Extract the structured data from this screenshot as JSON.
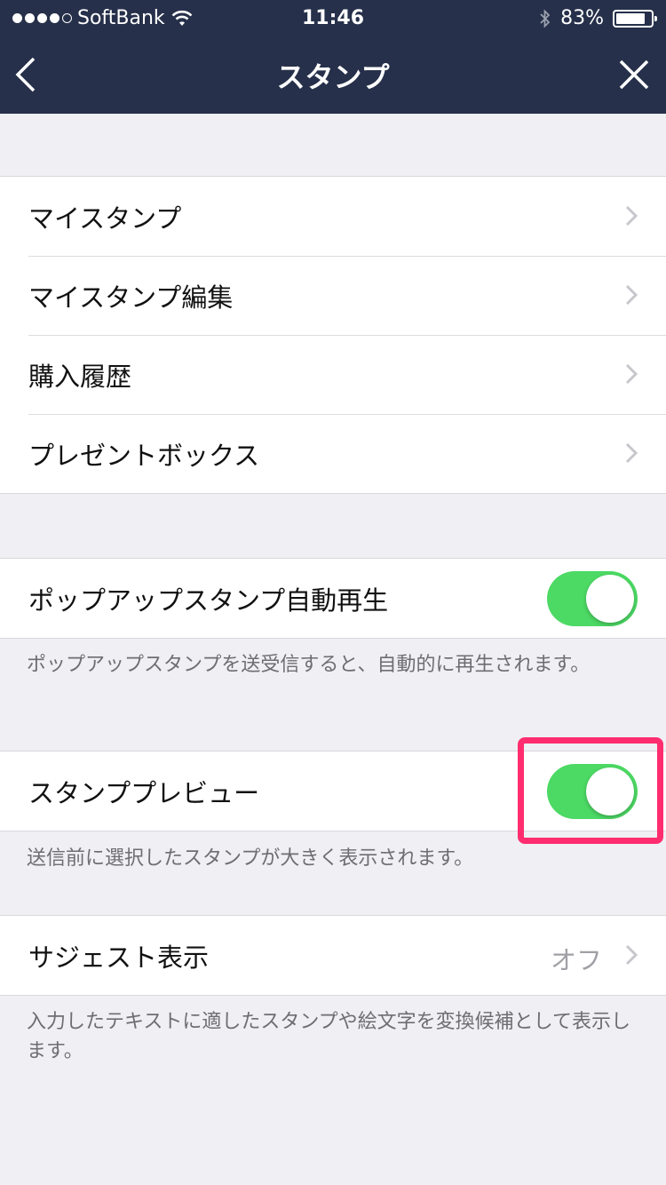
{
  "status_bar": {
    "carrier": "SoftBank",
    "time": "11:46",
    "battery_percent": "83%",
    "battery_level": 0.83,
    "signal_dots_filled": 4,
    "signal_dots_total": 5
  },
  "nav": {
    "title": "スタンプ",
    "back_icon": "chevron-left-icon",
    "close_icon": "close-icon"
  },
  "menu": {
    "items": [
      {
        "label": "マイスタンプ"
      },
      {
        "label": "マイスタンプ編集"
      },
      {
        "label": "購入履歴"
      },
      {
        "label": "プレゼントボックス"
      }
    ]
  },
  "popup_autoplay": {
    "label": "ポップアップスタンプ自動再生",
    "enabled": true,
    "description": "ポップアップスタンプを送受信すると、自動的に再生されます。"
  },
  "sticker_preview": {
    "label": "スタンププレビュー",
    "enabled": true,
    "description": "送信前に選択したスタンプが大きく表示されます。"
  },
  "suggest": {
    "label": "サジェスト表示",
    "value": "オフ",
    "description": "入力したテキストに適したスタンプや絵文字を変換候補として表示します。"
  },
  "colors": {
    "header_bg": "#26304a",
    "toggle_on": "#4cd964",
    "highlight": "#ff2d6f",
    "page_bg": "#efeff4"
  }
}
